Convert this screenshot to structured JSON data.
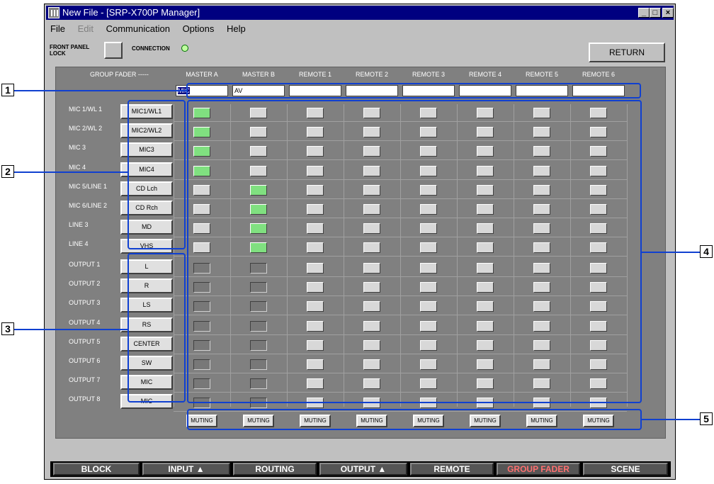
{
  "window": {
    "title": "New File - [SRP-X700P Manager]"
  },
  "menu": [
    "File",
    "Edit",
    "Communication",
    "Options",
    "Help"
  ],
  "front_panel": {
    "label_line1": "FRONT PANEL",
    "label_line2": "LOCK",
    "connection_label": "CONNECTION"
  },
  "return_label": "RETURN",
  "group_fader_label": "GROUP FADER -----",
  "columns": [
    "MASTER A",
    "MASTER B",
    "REMOTE 1",
    "REMOTE 2",
    "REMOTE 3",
    "REMOTE 4",
    "REMOTE 5",
    "REMOTE 6"
  ],
  "group_names": [
    "MIC",
    "AV",
    "",
    "",
    "",
    "",
    "",
    ""
  ],
  "inputs": [
    {
      "label": "MIC 1/WL 1",
      "button": "MIC1/WL1",
      "on": [
        1,
        0,
        0,
        0,
        0,
        0,
        0,
        0
      ]
    },
    {
      "label": "MIC 2/WL 2",
      "button": "MIC2/WL2",
      "on": [
        1,
        0,
        0,
        0,
        0,
        0,
        0,
        0
      ]
    },
    {
      "label": "MIC 3",
      "button": "MIC3",
      "on": [
        1,
        0,
        0,
        0,
        0,
        0,
        0,
        0
      ]
    },
    {
      "label": "MIC 4",
      "button": "MIC4",
      "on": [
        1,
        0,
        0,
        0,
        0,
        0,
        0,
        0
      ]
    },
    {
      "label": "MIC 5/LINE 1",
      "button": "CD Lch",
      "on": [
        0,
        1,
        0,
        0,
        0,
        0,
        0,
        0
      ]
    },
    {
      "label": "MIC 6/LINE 2",
      "button": "CD Rch",
      "on": [
        0,
        1,
        0,
        0,
        0,
        0,
        0,
        0
      ]
    },
    {
      "label": "LINE 3",
      "button": "MD",
      "on": [
        0,
        1,
        0,
        0,
        0,
        0,
        0,
        0
      ]
    },
    {
      "label": "LINE 4",
      "button": "VHS",
      "on": [
        0,
        1,
        0,
        0,
        0,
        0,
        0,
        0
      ]
    }
  ],
  "outputs": [
    {
      "label": "OUTPUT 1",
      "button": "L"
    },
    {
      "label": "OUTPUT 2",
      "button": "R"
    },
    {
      "label": "OUTPUT 3",
      "button": "LS"
    },
    {
      "label": "OUTPUT 4",
      "button": "RS"
    },
    {
      "label": "OUTPUT 5",
      "button": "CENTER"
    },
    {
      "label": "OUTPUT 6",
      "button": "SW"
    },
    {
      "label": "OUTPUT 7",
      "button": "MIC"
    },
    {
      "label": "OUTPUT 8",
      "button": "MIC"
    }
  ],
  "muting_label": "MUTING",
  "callouts": [
    "1",
    "2",
    "3",
    "4",
    "5"
  ],
  "nav": [
    {
      "label": "BLOCK",
      "active": false
    },
    {
      "label": "INPUT ▲",
      "active": false
    },
    {
      "label": "ROUTING",
      "active": false
    },
    {
      "label": "OUTPUT ▲",
      "active": false
    },
    {
      "label": "REMOTE",
      "active": false
    },
    {
      "label": "GROUP FADER",
      "active": true
    },
    {
      "label": "SCENE",
      "active": false
    }
  ],
  "colors": {
    "selected_on": "#80e080",
    "active_nav_text": "#ff7070",
    "callout_box": "#1040d0",
    "titlebar": "#000080"
  }
}
